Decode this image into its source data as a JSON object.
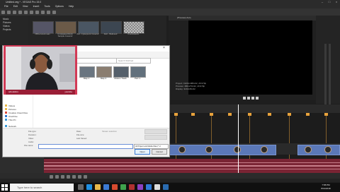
{
  "app": {
    "title": "Untitled.veg * - VEGAS Pro 15.0",
    "menu": [
      "File",
      "Edit",
      "View",
      "Insert",
      "Tools",
      "Options",
      "Help"
    ]
  },
  "explorer": {
    "tree": [
      "Music",
      "Pictures",
      "Videos",
      "Projects",
      "Creative Cloud Files",
      "OneDrive",
      "This PC"
    ],
    "thumbs": [
      "Office Hours.wav",
      "Unreleased Rock Sample.Coverstr",
      "Acc. Cyberpunk Coverstr",
      "ZaU - Believed",
      "Overshadow"
    ]
  },
  "preview": {
    "header": "(Preview) Auto",
    "info": [
      "Project: 1920x1080x32, 29.970p",
      "Preview: 480x270x32, 29.970p",
      "Display: 320x180x32"
    ]
  },
  "timeline": {
    "timecode": "00:00:00;00"
  },
  "dialog": {
    "title": "Import Media",
    "address": "Studio Innovation › Stitched",
    "search": "Search Stitched",
    "side_items": [
      "Quick access",
      "Desktop",
      "Downloads",
      "Documents",
      "Pictures",
      "Videos",
      "Creative Cloud Files",
      "OneDrive",
      "This PC",
      "Network"
    ],
    "files": [
      "Map 1",
      "Map 2",
      "Motion Track",
      "Part 1"
    ],
    "details_labels": [
      "File type:",
      "Duration:",
      "Video:",
      "Audio:"
    ],
    "details_labels2": [
      "Date:",
      "File size:",
      "Last Saved:"
    ],
    "details_value": "Stream selection",
    "file_name_label": "File name:",
    "file_type_value": "All Project and Media Files (*.d",
    "open_label": "Open",
    "cancel_label": "Cancel"
  },
  "webcam": {
    "name": "sdroolsbro",
    "handle": "youtube"
  },
  "taskbar": {
    "search_placeholder": "Type here to search",
    "time": "7:58 PM",
    "date": "8/13/2018"
  },
  "colors": {
    "accent": "#3a7bd5",
    "clip_blue": "#5b78b8",
    "audio_red": "#7a2434",
    "marker_orange": "#e8a23b",
    "cam_pink": "#d23a56"
  }
}
